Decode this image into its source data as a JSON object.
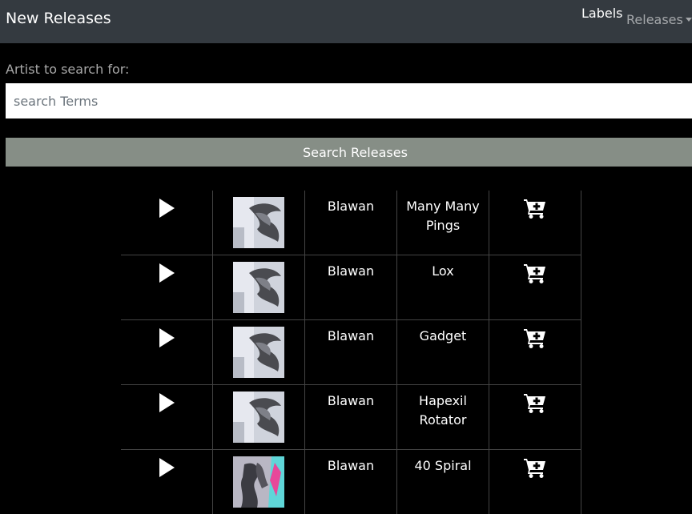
{
  "navbar": {
    "brand": "New Releases",
    "labels_link": "Labels",
    "releases_dropdown": "Releases"
  },
  "search": {
    "label": "Artist to search for:",
    "placeholder": "search Terms",
    "value": "",
    "button_label": "Search Releases"
  },
  "releases": [
    {
      "artist": "Blawan",
      "title": "Many Many Pings",
      "cover_icon": "cover-art-sculpture"
    },
    {
      "artist": "Blawan",
      "title": "Lox",
      "cover_icon": "cover-art-sculpture"
    },
    {
      "artist": "Blawan",
      "title": "Gadget",
      "cover_icon": "cover-art-sculpture"
    },
    {
      "artist": "Blawan",
      "title": "Hapexil Rotator",
      "cover_icon": "cover-art-sculpture"
    },
    {
      "artist": "Blawan",
      "title": "40 Spiral",
      "cover_icon": "cover-art-colored"
    }
  ],
  "icons": {
    "play": "play-icon",
    "add_to_cart": "cart-plus-icon"
  }
}
